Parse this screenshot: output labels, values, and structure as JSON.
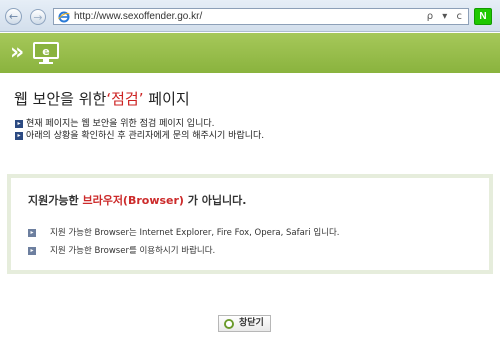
{
  "browser": {
    "url": "http://www.sexoffender.go.kr/",
    "back_glyph": "←",
    "forward_glyph": "→",
    "addr_tools": "ρ ▾ c",
    "n_button": "N"
  },
  "header": {
    "arrows": "»"
  },
  "page": {
    "title_prefix": "웹 보안을 위한",
    "title_highlight": "‘점검’",
    "title_suffix": "페이지",
    "intro_lines": [
      "현재 페이지는 웹 보안을 위한 점검 페이지 입니다.",
      "아래의 상황을 확인하신 후 관리자에게 문의 해주시기 바랍니다."
    ]
  },
  "notice": {
    "title_prefix": "지원가능한",
    "title_highlight": "브라우저(Browser)",
    "title_suffix": "가 아닙니다.",
    "items": [
      "지원 가능한 Browser는 Internet Explorer, Fire Fox, Opera, Safari 입니다.",
      "지원 가능한 Browser를 이용하시기 바랍니다."
    ]
  },
  "close_button": {
    "label": "창닫기",
    "icon_glyph": "●"
  },
  "colors": {
    "banner_green": "#8ab33e",
    "highlight_red": "#cc2222",
    "notice_border": "#e6eddc",
    "bullet_navy": "#2c4a82"
  }
}
